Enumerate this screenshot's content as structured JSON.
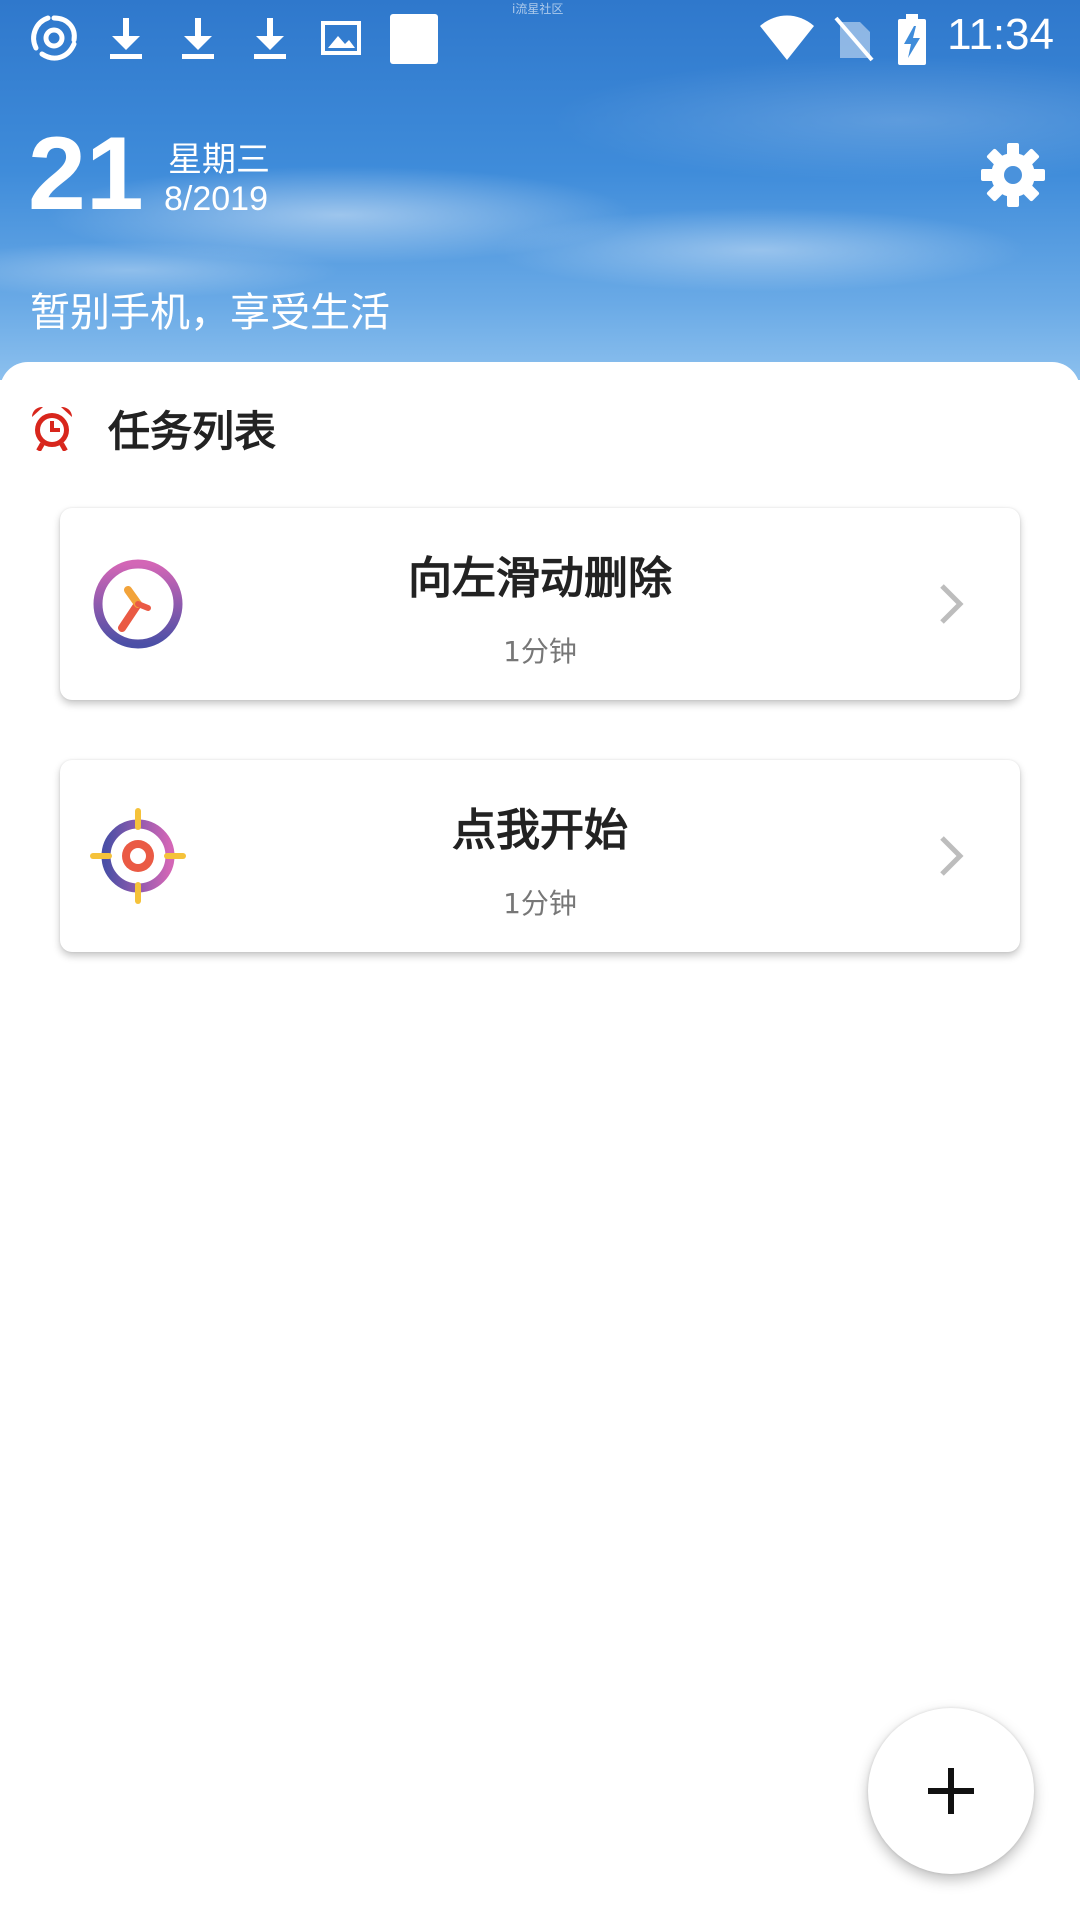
{
  "status_bar": {
    "time": "11:34",
    "watermark": "i流星社区",
    "left_icons": [
      "swirl-app-icon",
      "download-icon",
      "download-icon",
      "download-icon",
      "image-icon",
      "blank-notification-icon"
    ],
    "right_icons": [
      "wifi-icon",
      "no-sim-icon",
      "battery-charging-icon"
    ]
  },
  "header": {
    "day": "21",
    "weekday": "星期三",
    "month_year": "8/2019",
    "slogan": "暂别手机，享受生活",
    "settings_icon": "gear-icon"
  },
  "task_list": {
    "title": "任务列表",
    "icon": "alarm-clock-icon",
    "icon_color": "#d8261c",
    "tasks": [
      {
        "title": "向左滑动删除",
        "duration": "1分钟",
        "icon": "clock-icon"
      },
      {
        "title": "点我开始",
        "duration": "1分钟",
        "icon": "target-icon"
      }
    ]
  },
  "fab": {
    "icon": "plus-icon"
  },
  "colors": {
    "header_sky": "#3f8cda",
    "card_bg": "#ffffff",
    "text_primary": "#222222",
    "text_secondary": "#777777"
  }
}
